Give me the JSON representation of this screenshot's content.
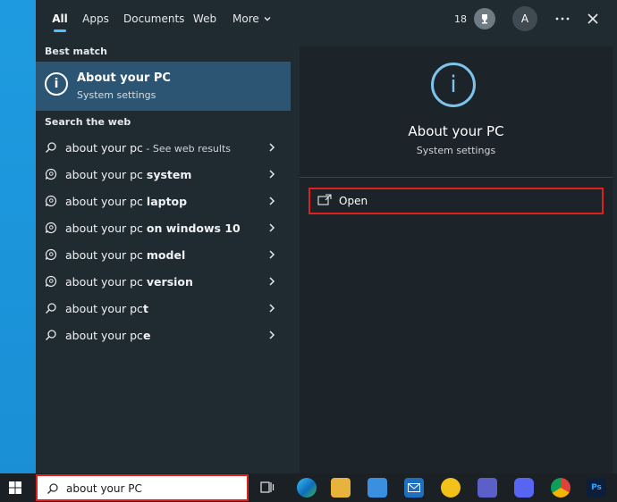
{
  "tabs": [
    {
      "label": "All",
      "active": true
    },
    {
      "label": "Apps"
    },
    {
      "label": "Documents"
    },
    {
      "label": "Web"
    },
    {
      "label": "More"
    }
  ],
  "header": {
    "points": "18",
    "avatar_letter": "A",
    "more_icon": "ellipsis-icon",
    "close_icon": "close-icon"
  },
  "best_match": {
    "section_label": "Best match",
    "title": "About your PC",
    "subtitle": "System settings",
    "icon": "info-icon"
  },
  "web": {
    "section_label": "Search the web",
    "items": [
      {
        "prefix": "about your pc",
        "suffix": " - See web results",
        "bold": "",
        "icon": "search-icon"
      },
      {
        "prefix": "about your pc ",
        "bold": "system",
        "icon": "search-bubble-icon"
      },
      {
        "prefix": "about your pc ",
        "bold": "laptop",
        "icon": "search-bubble-icon"
      },
      {
        "prefix": "about your pc ",
        "bold": "on windows 10",
        "icon": "search-bubble-icon"
      },
      {
        "prefix": "about your pc ",
        "bold": "model",
        "icon": "search-bubble-icon"
      },
      {
        "prefix": "about your pc ",
        "bold": "version",
        "icon": "search-bubble-icon"
      },
      {
        "prefix": "about your pc",
        "bold": "t",
        "icon": "search-icon"
      },
      {
        "prefix": "about your pc",
        "bold": "e",
        "icon": "search-icon"
      }
    ]
  },
  "preview": {
    "title": "About your PC",
    "subtitle": "System settings",
    "open_label": "Open",
    "icon": "info-icon"
  },
  "taskbar": {
    "search_value": "about your PC",
    "apps": [
      {
        "name": "task-view-icon",
        "color": "#1b2024"
      },
      {
        "name": "edge-icon",
        "color": "#0c8fc9"
      },
      {
        "name": "file-explorer-icon",
        "color": "#e8b33c"
      },
      {
        "name": "store-icon",
        "color": "#3a8fe0"
      },
      {
        "name": "mail-icon",
        "color": "#1d6fc0"
      },
      {
        "name": "norton-icon",
        "color": "#f2c21b"
      },
      {
        "name": "teams-icon",
        "color": "#5b5fc7"
      },
      {
        "name": "discord-icon",
        "color": "#5865f2"
      },
      {
        "name": "chrome-icon",
        "color": "#3aa757"
      },
      {
        "name": "photoshop-icon",
        "color": "#0c1e3a",
        "label": "Ps"
      }
    ]
  },
  "colors": {
    "accent": "#4cc2ff",
    "highlight": "#2c5573",
    "annotation_red": "#e0201c"
  }
}
